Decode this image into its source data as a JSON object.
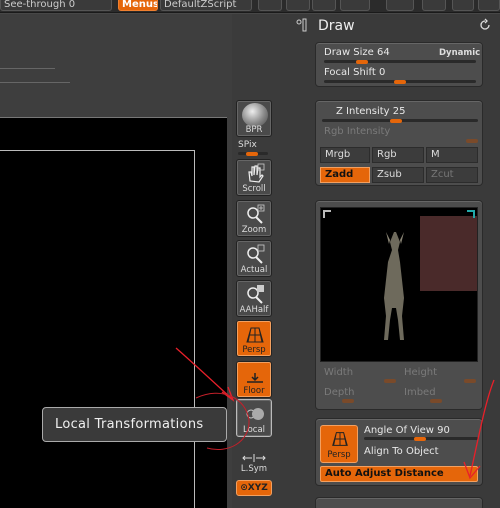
{
  "topbar": {
    "see_through": "See-through   0",
    "menus": "Menus",
    "default_script": "DefaultZScript"
  },
  "shelf": {
    "bpr": "BPR",
    "spix": "SPix",
    "scroll": "Scroll",
    "zoom": "Zoom",
    "actual": "Actual",
    "aahalf": "AAHalf",
    "persp": "Persp",
    "floor": "Floor",
    "local": "Local",
    "lsym": "L.Sym",
    "xyz": "⊙XYZ"
  },
  "tooltip": "Local Transformations",
  "draw": {
    "title": "Draw",
    "draw_size_label": "Draw Size",
    "draw_size_value": "64",
    "dynamic": "Dynamic",
    "focal_shift_label": "Focal Shift",
    "focal_shift_value": "0",
    "z_intensity_label": "Z Intensity",
    "z_intensity_value": "25",
    "rgb_intensity": "Rgb Intensity",
    "mrgb": "Mrgb",
    "rgb": "Rgb",
    "m": "M",
    "zadd": "Zadd",
    "zsub": "Zsub",
    "zcut": "Zcut",
    "width": "Width",
    "height": "Height",
    "depth": "Depth",
    "imbed": "Imbed",
    "angle_of_view_label": "Angle Of View",
    "angle_of_view_value": "90",
    "align_to_object": "Align To Object",
    "auto_adjust_distance": "Auto Adjust Distance",
    "persp": "Persp"
  },
  "colors": {
    "accent": "#e5660a",
    "annotation": "#e8202a"
  }
}
